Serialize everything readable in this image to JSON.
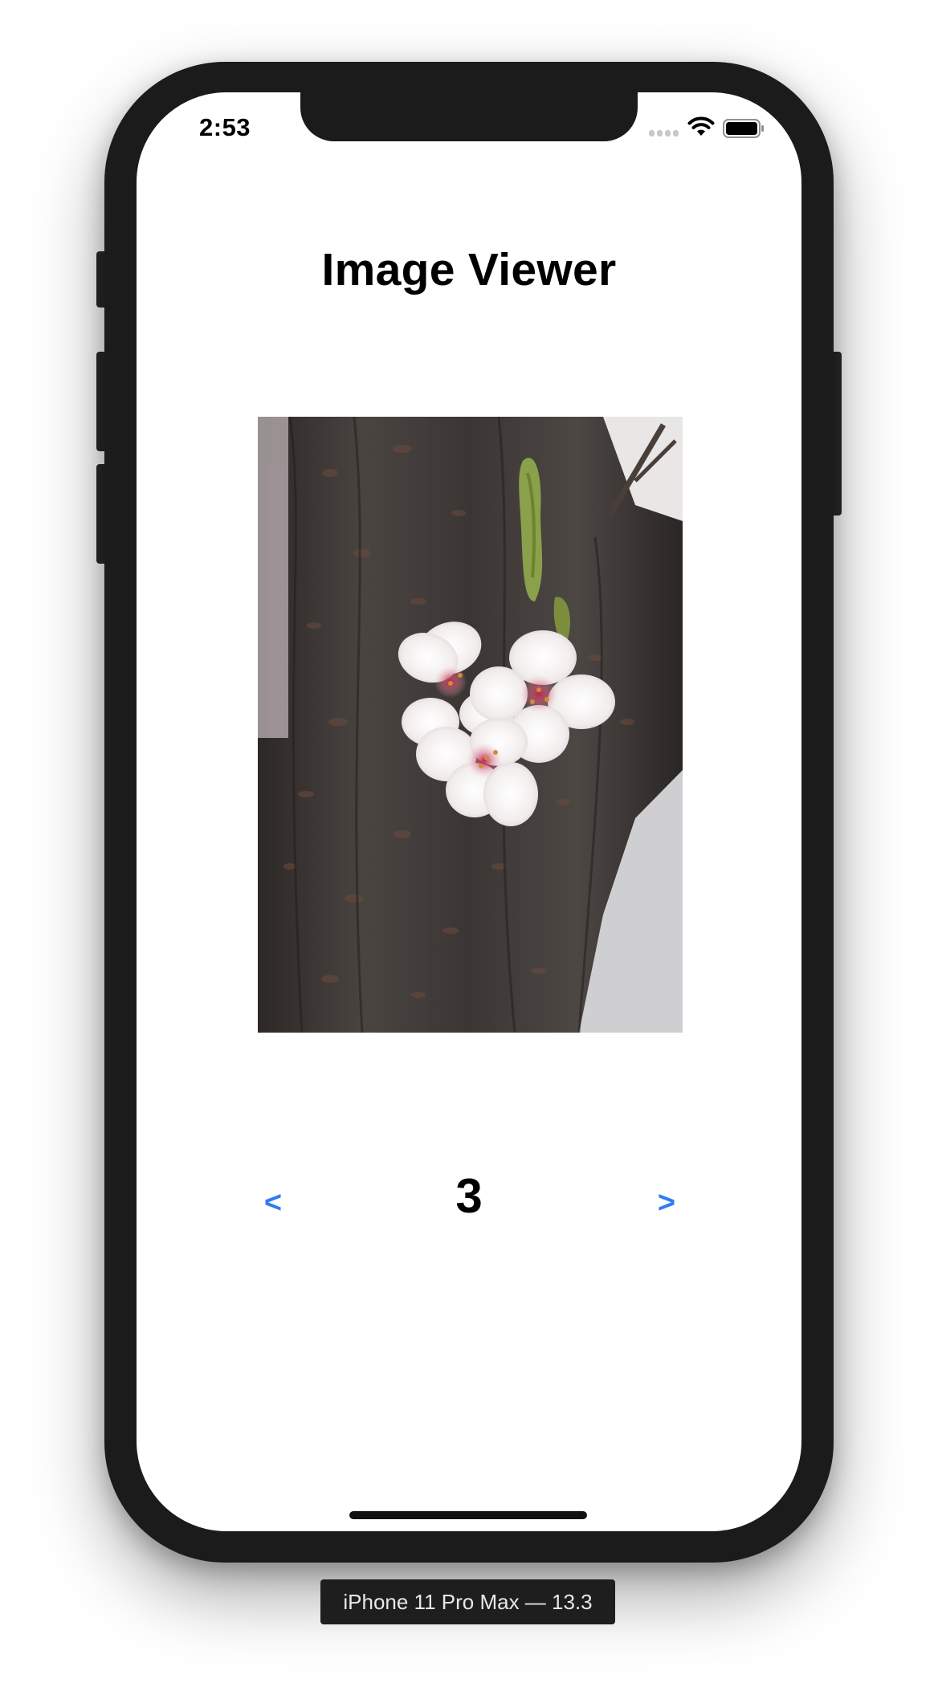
{
  "status_bar": {
    "time": "2:53",
    "signal_icon": "cellular-signal-icon",
    "wifi_icon": "wifi-icon",
    "battery_icon": "battery-icon"
  },
  "app": {
    "title": "Image Viewer",
    "image": {
      "subject": "cherry blossom on tree trunk"
    },
    "navigation": {
      "prev_label": "<",
      "current_index": "3",
      "next_label": ">"
    },
    "colors": {
      "accent": "#2f7cf6",
      "text": "#000000",
      "device_frame": "#1b1b1c"
    }
  },
  "simulator": {
    "device_label": "iPhone 11 Pro Max — 13.3"
  }
}
